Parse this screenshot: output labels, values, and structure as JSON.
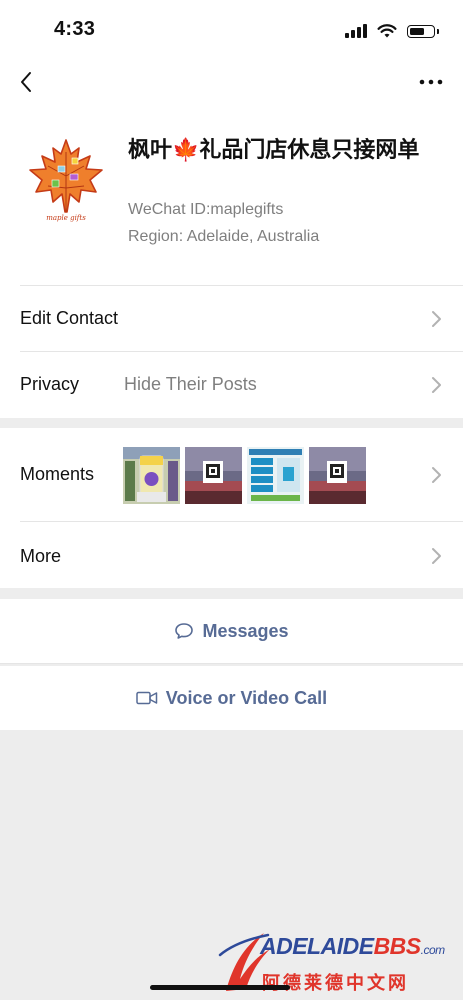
{
  "status": {
    "time": "4:33",
    "battery_level": 0.55
  },
  "profile": {
    "name": "枫叶🍁礼品门店休息只接网单",
    "wechat_id": "WeChat ID:maplegifts",
    "region": "Region: Adelaide, Australia",
    "avatar_text": "maple gifts"
  },
  "rows": {
    "edit_contact": "Edit Contact",
    "privacy_label": "Privacy",
    "privacy_value": "Hide Their Posts",
    "moments_label": "Moments",
    "more_label": "More"
  },
  "actions": {
    "messages": "Messages",
    "call": "Voice or Video Call"
  },
  "watermark": {
    "brand_part1": "ADELAIDE",
    "brand_part2": "BBS",
    "brand_suffix": ".com",
    "chinese": "阿德莱德中文网"
  },
  "colors": {
    "link": "#576b95",
    "separator": "#ededed",
    "accent_red": "#e0352b",
    "accent_blue": "#2e4a9a"
  }
}
